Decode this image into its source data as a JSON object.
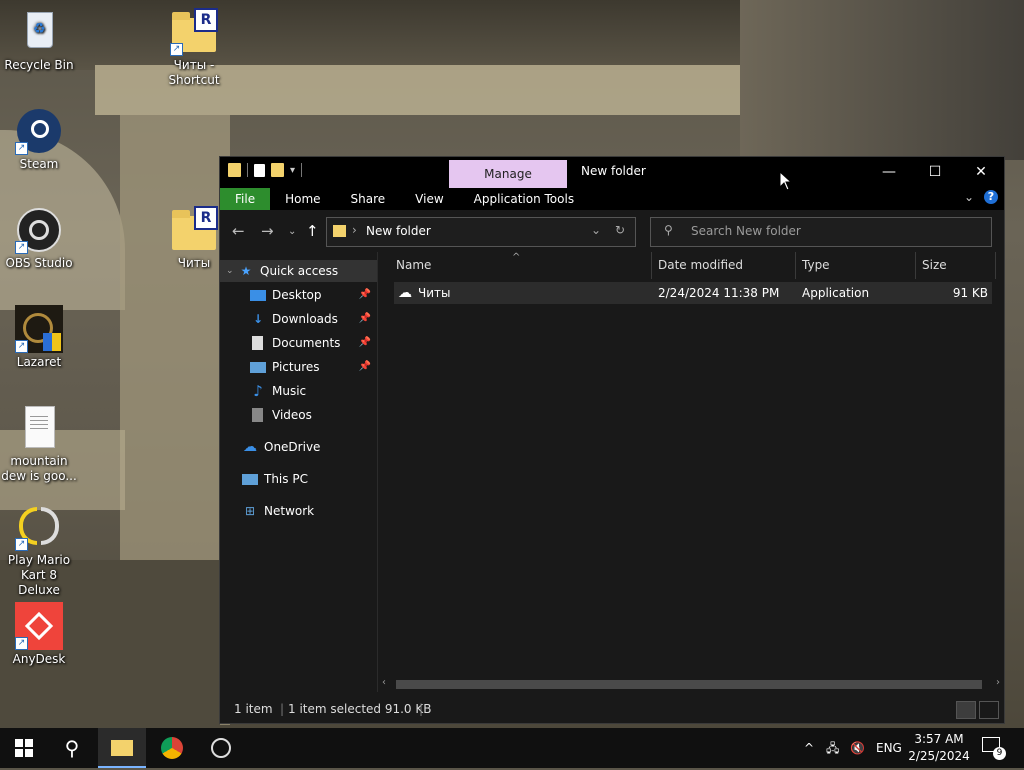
{
  "desktop": {
    "icons": [
      {
        "label": "Recycle Bin",
        "icon": "recycle-bin-icon"
      },
      {
        "label": "Steam",
        "icon": "steam-icon"
      },
      {
        "label": "OBS Studio",
        "icon": "obs-icon"
      },
      {
        "label": "Lazaret",
        "icon": "lazaret-icon"
      },
      {
        "label": "mountain dew is goo...",
        "icon": "text-file-icon"
      },
      {
        "label": "Play Mario Kart 8 Deluxe",
        "icon": "yuzu-icon"
      },
      {
        "label": "AnyDesk",
        "icon": "anydesk-icon"
      },
      {
        "label": "Читы - Shortcut",
        "icon": "folder-shortcut-icon",
        "badge": "R"
      },
      {
        "label": "Читы",
        "icon": "folder-icon",
        "badge": "R"
      }
    ]
  },
  "explorer": {
    "manage_label": "Manage",
    "title": "New folder",
    "window_buttons": {
      "minimize": "—",
      "maximize": "☐",
      "close": "✕"
    },
    "ribbon": {
      "tabs": [
        "File",
        "Home",
        "Share",
        "View",
        "Application Tools"
      ],
      "help": "?"
    },
    "address": {
      "path": "New folder"
    },
    "search": {
      "placeholder": "Search New folder"
    },
    "nav": {
      "quick_access": "Quick access",
      "items": [
        {
          "label": "Desktop",
          "pinned": true
        },
        {
          "label": "Downloads",
          "pinned": true
        },
        {
          "label": "Documents",
          "pinned": true
        },
        {
          "label": "Pictures",
          "pinned": true
        },
        {
          "label": "Music",
          "pinned": false
        },
        {
          "label": "Videos",
          "pinned": false
        }
      ],
      "onedrive": "OneDrive",
      "this_pc": "This PC",
      "network": "Network"
    },
    "columns": {
      "name": "Name",
      "date": "Date modified",
      "type": "Type",
      "size": "Size"
    },
    "files": [
      {
        "name": "Читы",
        "date": "2/24/2024 11:38 PM",
        "type": "Application",
        "size": "91 KB"
      }
    ],
    "status": {
      "count": "1 item",
      "selected": "1 item selected  91.0 KB"
    }
  },
  "taskbar": {
    "tray": {
      "language": "ENG",
      "time": "3:57 AM",
      "date": "2/25/2024",
      "notifications": "9"
    }
  }
}
